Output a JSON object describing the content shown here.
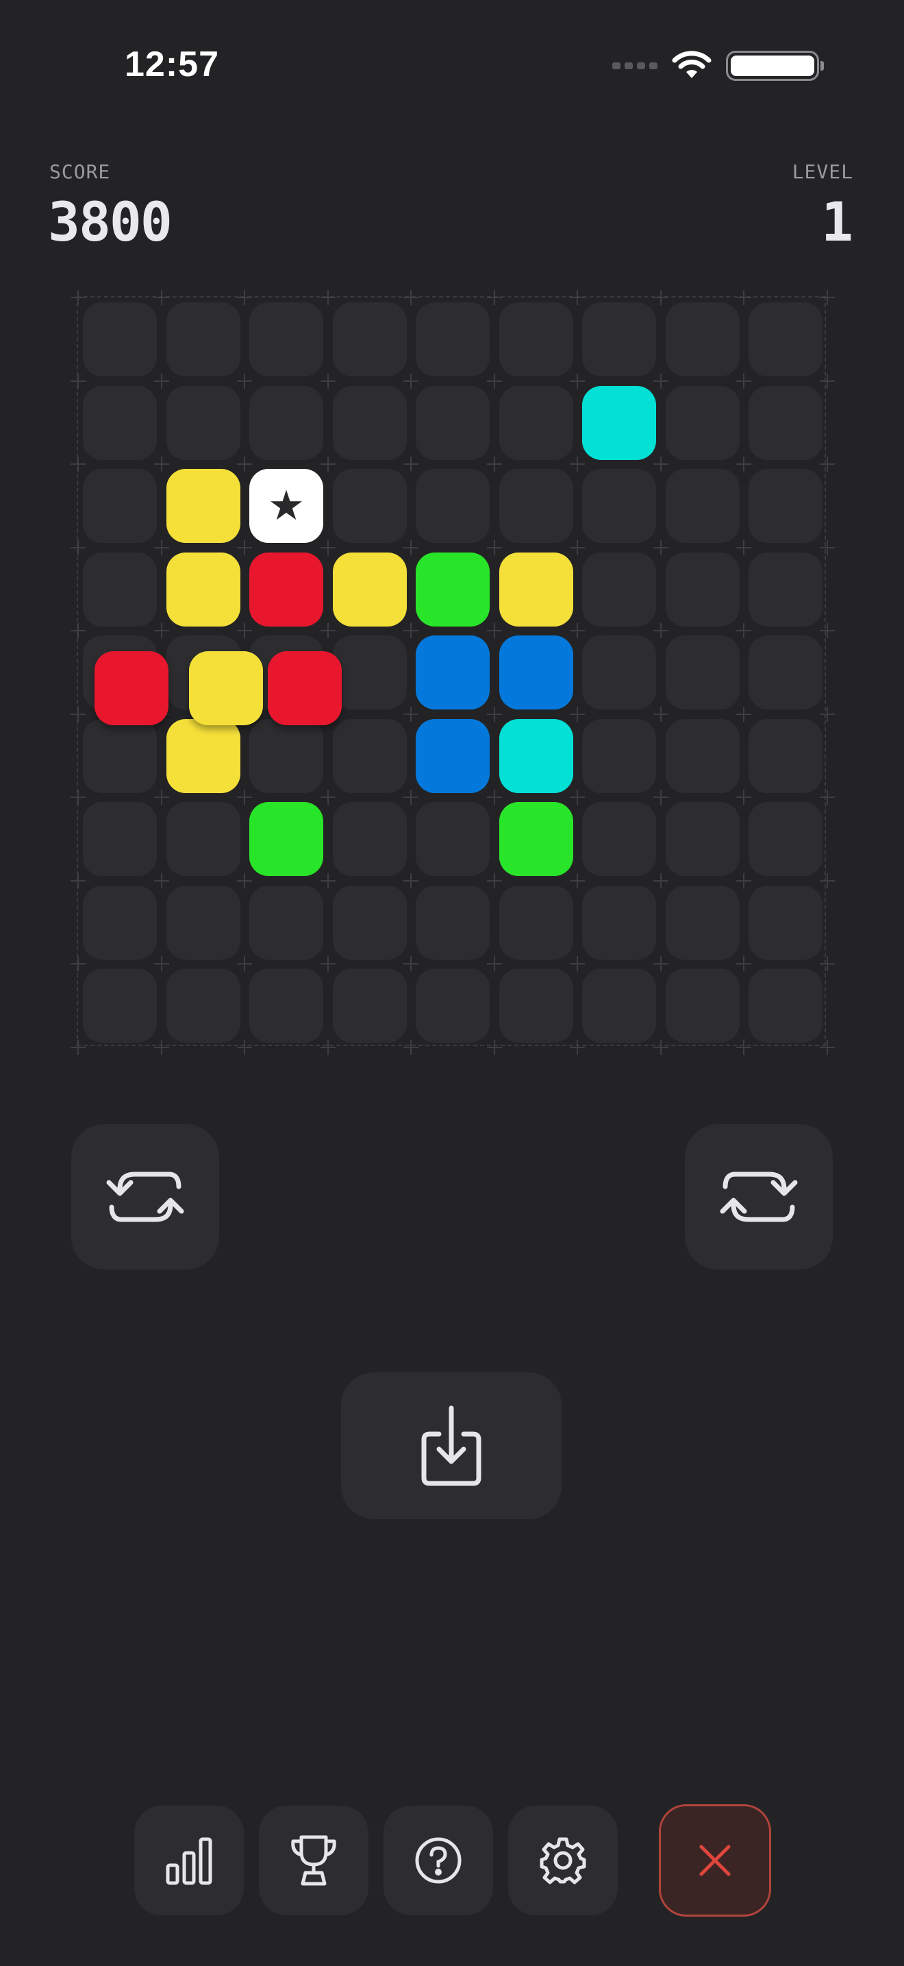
{
  "status_bar": {
    "time": "12:57"
  },
  "hud": {
    "score_label": "SCORE",
    "score_value": "3800",
    "level_label": "LEVEL",
    "level_value": "1"
  },
  "board": {
    "rows": 9,
    "cols": 9,
    "placed_tiles": [
      {
        "row": 1,
        "col": 6,
        "color": "cyan"
      },
      {
        "row": 2,
        "col": 1,
        "color": "yellow"
      },
      {
        "row": 2,
        "col": 2,
        "color": "white",
        "star": true
      },
      {
        "row": 3,
        "col": 1,
        "color": "yellow"
      },
      {
        "row": 3,
        "col": 2,
        "color": "red"
      },
      {
        "row": 3,
        "col": 3,
        "color": "yellow"
      },
      {
        "row": 3,
        "col": 4,
        "color": "green"
      },
      {
        "row": 3,
        "col": 5,
        "color": "yellow"
      },
      {
        "row": 4,
        "col": 4,
        "color": "blue"
      },
      {
        "row": 4,
        "col": 5,
        "color": "blue"
      },
      {
        "row": 5,
        "col": 1,
        "color": "yellow"
      },
      {
        "row": 5,
        "col": 4,
        "color": "blue"
      },
      {
        "row": 5,
        "col": 5,
        "color": "cyan"
      },
      {
        "row": 6,
        "col": 2,
        "color": "green"
      },
      {
        "row": 6,
        "col": 5,
        "color": "green"
      }
    ],
    "active_piece": [
      "red",
      "yellow",
      "red"
    ]
  },
  "controls": {
    "rotate_left_icon": "rotate-counterclockwise-icon",
    "rotate_right_icon": "rotate-clockwise-icon",
    "drop_icon": "drop-down-icon"
  },
  "toolbar": {
    "items": [
      "stats-icon",
      "trophy-icon",
      "help-icon",
      "gear-icon",
      "close-icon"
    ]
  },
  "colors": {
    "background": "#232325",
    "cell": "#2d2d30",
    "yellow": "#f5e03a",
    "red": "#e8172d",
    "green": "#29e52a",
    "blue": "#0479db",
    "cyan": "#03e0d6",
    "white": "#ffffff",
    "close_accent": "#e0463c"
  }
}
